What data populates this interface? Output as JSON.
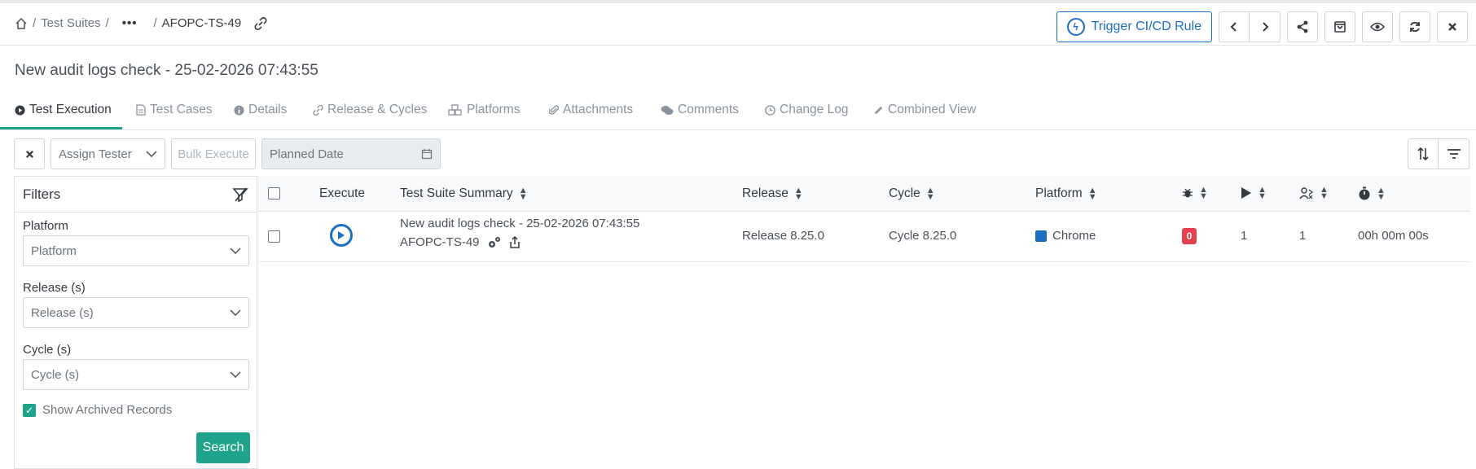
{
  "breadcrumb": {
    "home_icon": "home-icon",
    "item1": "Test Suites",
    "sep": "/",
    "more": "•••",
    "current": "AFOPC-TS-49",
    "link_icon": "link-icon"
  },
  "header_actions": {
    "trigger_label": "Trigger CI/CD Rule"
  },
  "page": {
    "title": "New audit logs check - 25-02-2026 07:43:55"
  },
  "tabs": [
    {
      "label": "Test Execution",
      "icon": "play-circle-icon"
    },
    {
      "label": "Test Cases",
      "icon": "file-icon"
    },
    {
      "label": "Details",
      "icon": "info-icon"
    },
    {
      "label": "Release & Cycles",
      "icon": "link-icon"
    },
    {
      "label": "Platforms",
      "icon": "cubes-icon"
    },
    {
      "label": "Attachments",
      "icon": "paperclip-icon"
    },
    {
      "label": "Comments",
      "icon": "comments-icon"
    },
    {
      "label": "Change Log",
      "icon": "clock-icon"
    },
    {
      "label": "Combined View",
      "icon": "pencil-icon"
    }
  ],
  "toolbar": {
    "assign_tester": "Assign Tester",
    "bulk_execute": "Bulk Execute",
    "planned_date_placeholder": "Planned Date"
  },
  "filters": {
    "title": "Filters",
    "platform_label": "Platform",
    "platform_value": "Platform",
    "release_label": "Release (s)",
    "release_value": "Release (s)",
    "cycle_label": "Cycle (s)",
    "cycle_value": "Cycle (s)",
    "show_archived": "Show Archived Records",
    "show_archived_checked": true,
    "search_label": "Search"
  },
  "table": {
    "columns": {
      "execute": "Execute",
      "summary": "Test Suite Summary",
      "release": "Release",
      "cycle": "Cycle",
      "platform": "Platform"
    },
    "rows": [
      {
        "summary": "New audit logs check - 25-02-2026 07:43:55",
        "key": "AFOPC-TS-49",
        "release": "Release 8.25.0",
        "cycle": "Cycle 8.25.0",
        "platform": "Chrome",
        "defects": "0",
        "executions": "1",
        "assigned": "1",
        "duration": "00h 00m 00s"
      }
    ]
  },
  "colors": {
    "accent": "#1fa38a",
    "primary": "#1b6ec2",
    "danger": "#e5404f"
  }
}
